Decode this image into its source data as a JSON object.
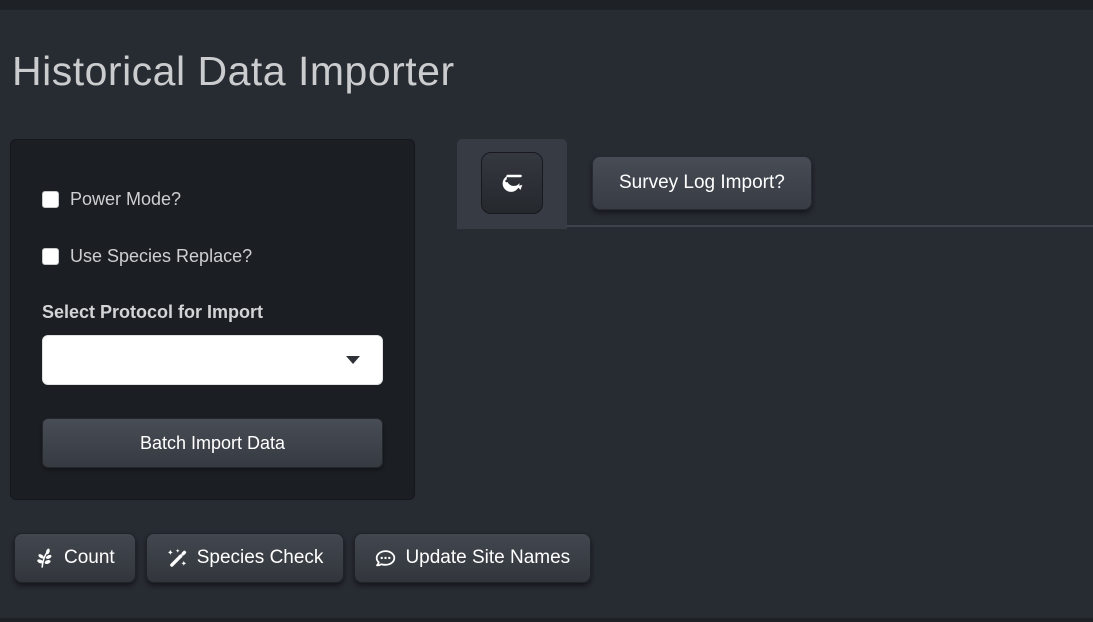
{
  "page": {
    "title": "Historical Data Importer"
  },
  "import_panel": {
    "power_mode_label": "Power Mode?",
    "power_mode_checked": false,
    "species_replace_label": "Use Species Replace?",
    "species_replace_checked": false,
    "protocol_label": "Select Protocol for Import",
    "protocol_value": "",
    "batch_import_label": "Batch Import Data"
  },
  "tabs": [
    {
      "id": "shrimp-import",
      "icon": "shrimp-icon",
      "label": "",
      "active": true
    },
    {
      "id": "survey-log-import",
      "label": "Survey Log Import?",
      "active": false
    }
  ],
  "action_buttons": [
    {
      "icon": "leaf-icon",
      "label": "Count"
    },
    {
      "icon": "wand-magic-sparkles-icon",
      "label": "Species Check"
    },
    {
      "icon": "comment-dots-icon",
      "label": "Update Site Names"
    }
  ],
  "colors": {
    "page_bg": "#272b32",
    "chrome_bar": "#1e2126",
    "panel_bg": "#1b1e23",
    "tab_active_bg": "#373c44",
    "tab_underline": "#3d424b",
    "select_bg": "#ffffff",
    "button_gradient_top": "#42474f",
    "button_gradient_bottom": "#32363c",
    "text": "#cdcfd1"
  }
}
